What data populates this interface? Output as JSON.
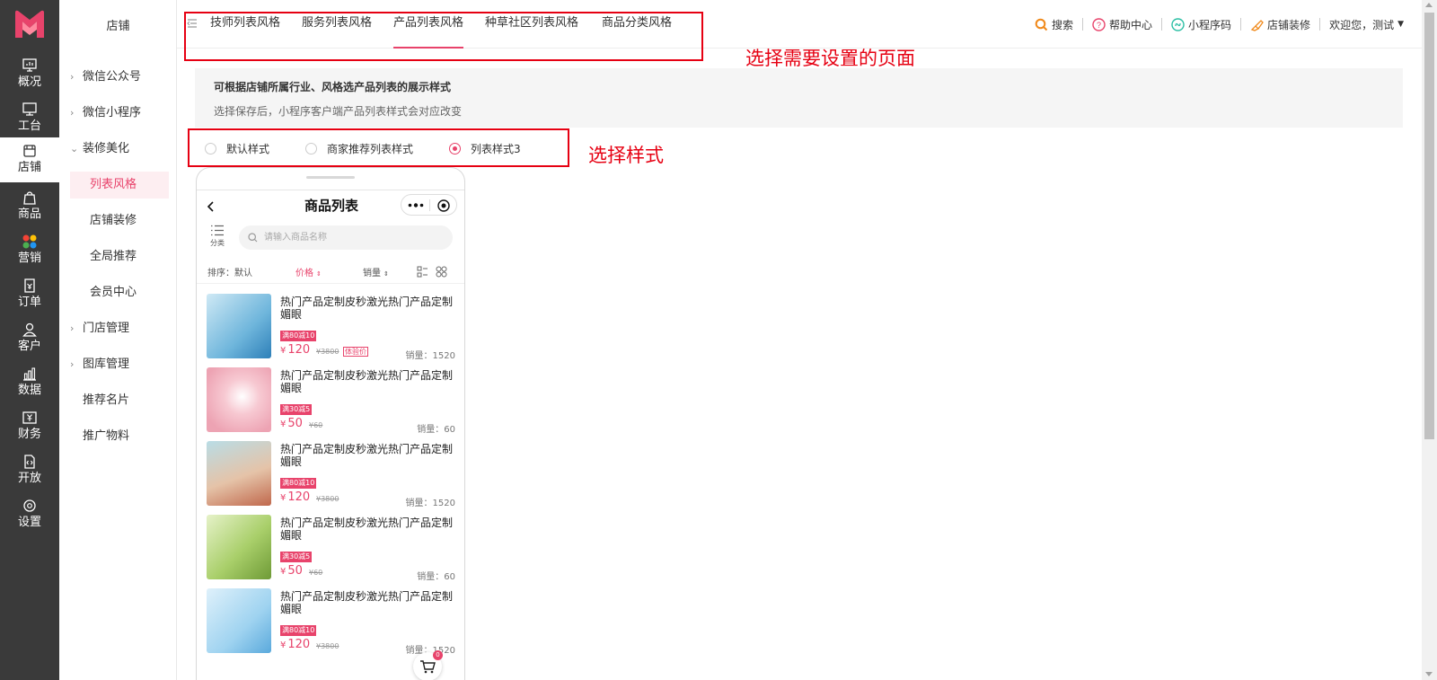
{
  "rail": {
    "items": [
      {
        "label": "概况",
        "icon": "monitor-chart-icon"
      },
      {
        "label": "工台",
        "icon": "desktop-icon"
      },
      {
        "label": "店铺",
        "icon": "shop-icon"
      },
      {
        "label": "商品",
        "icon": "bag-icon"
      },
      {
        "label": "营销",
        "icon": "colored-dots-icon"
      },
      {
        "label": "订单",
        "icon": "order-icon"
      },
      {
        "label": "客户",
        "icon": "user-icon"
      },
      {
        "label": "数据",
        "icon": "bar-chart-icon"
      },
      {
        "label": "财务",
        "icon": "yuan-icon"
      },
      {
        "label": "开放",
        "icon": "code-file-icon"
      },
      {
        "label": "设置",
        "icon": "gear-icon"
      }
    ],
    "active": "店铺"
  },
  "sidebar": {
    "title": "店铺",
    "items": [
      {
        "label": "微信公众号"
      },
      {
        "label": "微信小程序"
      },
      {
        "label": "装修美化"
      },
      {
        "label": "列表风格"
      },
      {
        "label": "店铺装修"
      },
      {
        "label": "全局推荐"
      },
      {
        "label": "会员中心"
      },
      {
        "label": "门店管理"
      },
      {
        "label": "图库管理"
      },
      {
        "label": "推荐名片"
      },
      {
        "label": "推广物料"
      }
    ]
  },
  "tabs": [
    {
      "label": "技师列表风格"
    },
    {
      "label": "服务列表风格"
    },
    {
      "label": "产品列表风格"
    },
    {
      "label": "种草社区列表风格"
    },
    {
      "label": "商品分类风格"
    }
  ],
  "topbar": {
    "search": "搜索",
    "help": "帮助中心",
    "miniprogram": "小程序码",
    "decorate": "店铺装修",
    "welcome": "欢迎您，测试"
  },
  "annotations": {
    "select_page": "选择需要设置的页面",
    "select_style": "选择样式"
  },
  "info": {
    "title": "可根据店铺所属行业、风格选产品列表的展示样式",
    "desc": "选择保存后，小程序客户端产品列表样式会对应改变"
  },
  "style_options": [
    {
      "label": "默认样式",
      "selected": false
    },
    {
      "label": "商家推荐列表样式",
      "selected": false
    },
    {
      "label": "列表样式3",
      "selected": true
    }
  ],
  "phone": {
    "title": "商品列表",
    "category_label": "分类",
    "search_placeholder": "请输入商品名称",
    "sort_default": "排序：默认",
    "sort_price": "价格",
    "sort_sales": "销量",
    "cart_count": "0",
    "products": [
      {
        "name": "热门产品定制皮秒激光热门产品定制媚眼",
        "tag": "满80减10",
        "currency": "¥",
        "price": "120",
        "original": "¥3800",
        "badge": "体验价",
        "sales": "销量：1520"
      },
      {
        "name": "热门产品定制皮秒激光热门产品定制媚眼",
        "tag": "满30减5",
        "currency": "¥",
        "price": "50",
        "original": "¥60",
        "badge": "",
        "sales": "销量：60"
      },
      {
        "name": "热门产品定制皮秒激光热门产品定制媚眼",
        "tag": "满80减10",
        "currency": "¥",
        "price": "120",
        "original": "¥3800",
        "badge": "",
        "sales": "销量：1520"
      },
      {
        "name": "热门产品定制皮秒激光热门产品定制媚眼",
        "tag": "满30减5",
        "currency": "¥",
        "price": "50",
        "original": "¥60",
        "badge": "",
        "sales": "销量：60"
      },
      {
        "name": "热门产品定制皮秒激光热门产品定制媚眼",
        "tag": "满80减10",
        "currency": "¥",
        "price": "120",
        "original": "¥3800",
        "badge": "",
        "sales": "销量：1520"
      }
    ]
  },
  "colors": {
    "accent": "#e8436b",
    "rail_bg": "#3a3a3a",
    "annotation_red": "#e60012"
  }
}
